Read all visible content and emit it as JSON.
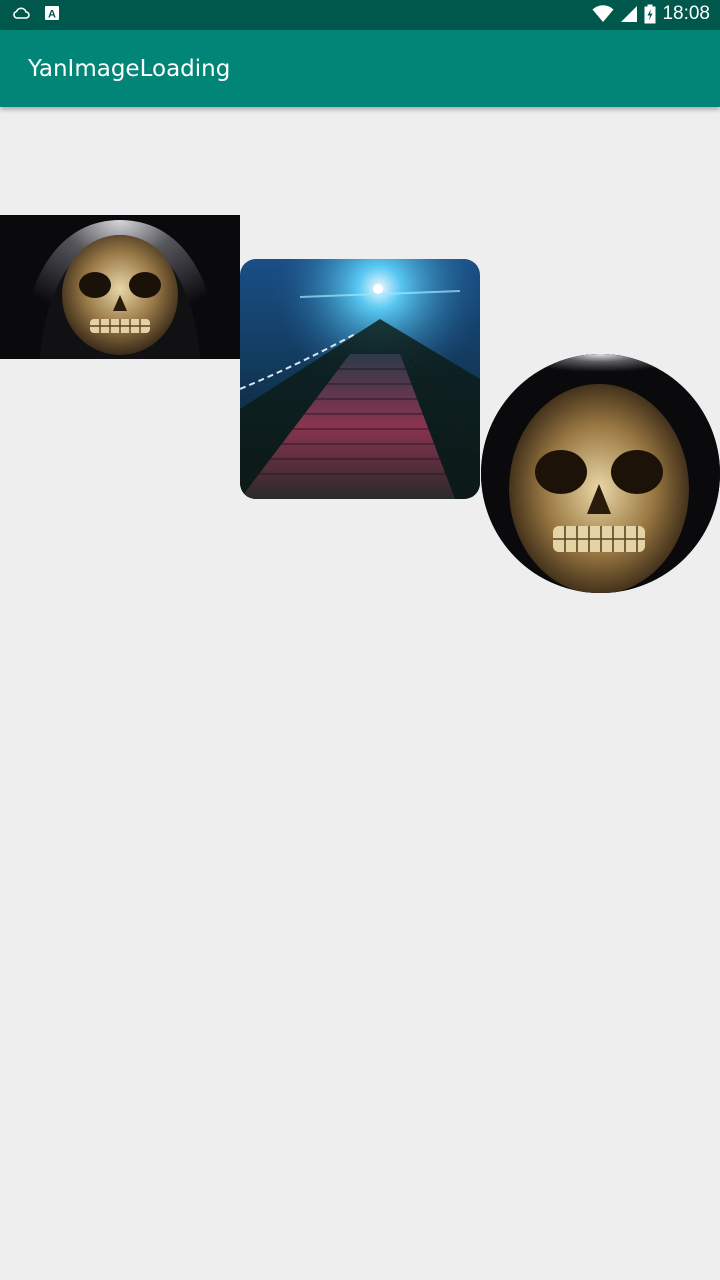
{
  "status_bar": {
    "time": "18:08",
    "left_icons": [
      "cloud-icon",
      "app-a-icon"
    ],
    "right_icons": [
      "wifi-icon",
      "signal-icon",
      "battery-charging-icon"
    ],
    "app_icon_letter": "A"
  },
  "app_bar": {
    "title": "YanImageLoading"
  },
  "images": [
    {
      "name": "skull-image-rect",
      "shape": "rectangle",
      "subject": "hooded skull"
    },
    {
      "name": "stairs-image-rounded",
      "shape": "rounded-corners",
      "subject": "night stairway with lights"
    },
    {
      "name": "skull-image-circle",
      "shape": "circle",
      "subject": "hooded skull"
    }
  ],
  "colors": {
    "status_bar": "#00574b",
    "app_bar": "#008577",
    "background": "#eeeeee"
  }
}
